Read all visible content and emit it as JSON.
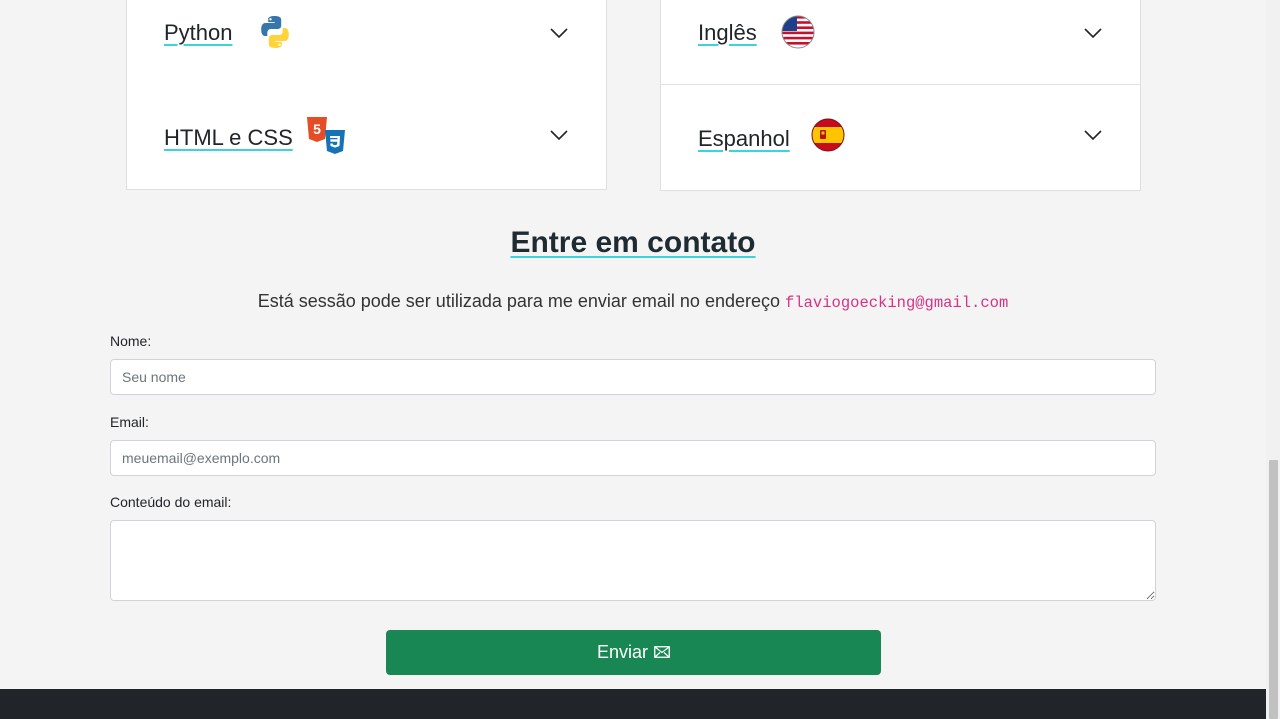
{
  "skills": {
    "left": [
      {
        "label": "Python",
        "icon": "python-icon"
      },
      {
        "label": "HTML e CSS",
        "icon": "html-css-icon"
      }
    ],
    "right": [
      {
        "label": "Inglês",
        "icon": "us-flag-icon"
      },
      {
        "label": "Espanhol",
        "icon": "spain-flag-icon"
      }
    ]
  },
  "contact": {
    "title": "Entre em contato",
    "description": "Está sessão pode ser utilizada para me enviar email no endereço",
    "email": "flaviogoecking@gmail.com",
    "name_label": "Nome:",
    "name_placeholder": "Seu nome",
    "email_label": "Email:",
    "email_placeholder": "meuemail@exemplo.com",
    "content_label": "Conteúdo do email:",
    "submit_label": "Enviar",
    "submit_icon": "envelope-icon"
  },
  "colors": {
    "accent_underline": "#3cd3e0",
    "submit_bg": "#198754",
    "footer_bg": "#212529",
    "email_code": "#d63384"
  }
}
